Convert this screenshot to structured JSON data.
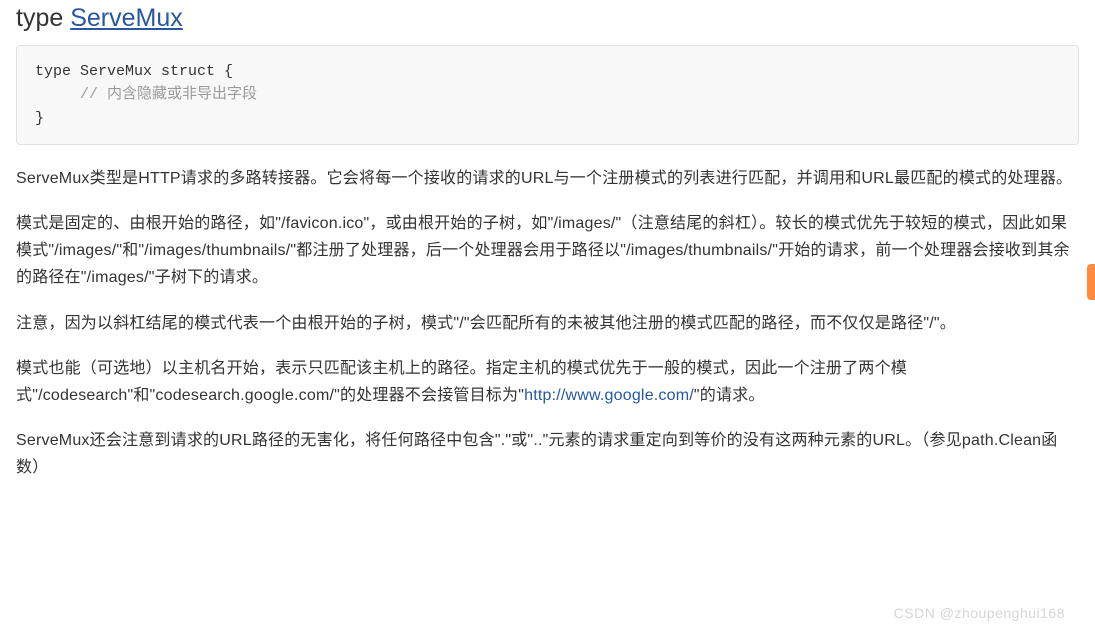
{
  "heading": {
    "keyword": "type",
    "typename": "ServeMux"
  },
  "code": {
    "line1": "type ServeMux struct {",
    "comment_indent": "     // ",
    "comment_text": "内含隐藏或非导出字段",
    "line3": "}"
  },
  "paragraphs": {
    "p1": "ServeMux类型是HTTP请求的多路转接器。它会将每一个接收的请求的URL与一个注册模式的列表进行匹配，并调用和URL最匹配的模式的处理器。",
    "p2": "模式是固定的、由根开始的路径，如\"/favicon.ico\"，或由根开始的子树，如\"/images/\"（注意结尾的斜杠）。较长的模式优先于较短的模式，因此如果模式\"/images/\"和\"/images/thumbnails/\"都注册了处理器，后一个处理器会用于路径以\"/images/thumbnails/\"开始的请求，前一个处理器会接收到其余的路径在\"/images/\"子树下的请求。",
    "p3": "注意，因为以斜杠结尾的模式代表一个由根开始的子树，模式\"/\"会匹配所有的未被其他注册的模式匹配的路径，而不仅仅是路径\"/\"。",
    "p4_a": "模式也能（可选地）以主机名开始，表示只匹配该主机上的路径。指定主机的模式优先于一般的模式，因此一个注册了两个模式\"/codesearch\"和\"codesearch.google.com/\"的处理器不会接管目标为\"",
    "p4_link": "http://www.google.com/",
    "p4_b": "\"的请求。",
    "p5": "ServeMux还会注意到请求的URL路径的无害化，将任何路径中包含\".\"或\"..\"元素的请求重定向到等价的没有这两种元素的URL。（参见path.Clean函数）"
  },
  "watermark": "CSDN @zhoupenghui168"
}
